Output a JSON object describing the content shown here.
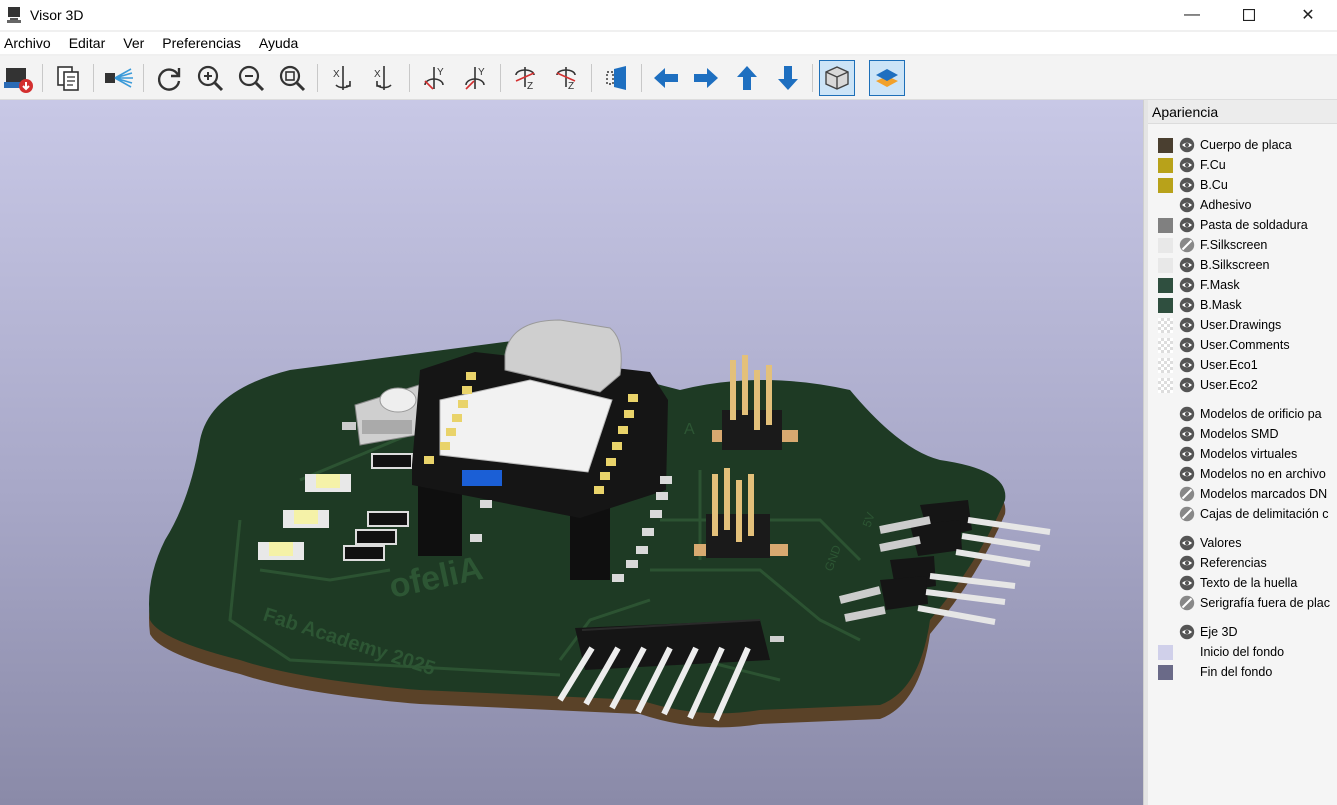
{
  "window": {
    "title": "Visor 3D"
  },
  "menu": [
    "Archivo",
    "Editar",
    "Ver",
    "Preferencias",
    "Ayuda"
  ],
  "panel": {
    "title": "Apariencia",
    "layers": [
      {
        "label": "Cuerpo de placa",
        "color": "#4a3f30",
        "visible": true
      },
      {
        "label": "F.Cu",
        "color": "#b8a21a",
        "visible": true
      },
      {
        "label": "B.Cu",
        "color": "#b8a21a",
        "visible": true
      },
      {
        "label": "Adhesivo",
        "color": "",
        "visible": true
      },
      {
        "label": "Pasta de soldadura",
        "color": "#808080",
        "visible": true
      },
      {
        "label": "F.Silkscreen",
        "color": "#e8e8e8",
        "visible": false
      },
      {
        "label": "B.Silkscreen",
        "color": "#e8e8e8",
        "visible": true
      },
      {
        "label": "F.Mask",
        "color": "#2f4f3f",
        "visible": true
      },
      {
        "label": "B.Mask",
        "color": "#2f4f3f",
        "visible": true
      },
      {
        "label": "User.Drawings",
        "color": "checker",
        "visible": true
      },
      {
        "label": "User.Comments",
        "color": "checker",
        "visible": true
      },
      {
        "label": "User.Eco1",
        "color": "checker",
        "visible": true
      },
      {
        "label": "User.Eco2",
        "color": "checker",
        "visible": true
      }
    ],
    "models": [
      {
        "label": "Modelos de orificio pa",
        "visible": true
      },
      {
        "label": "Modelos SMD",
        "visible": true
      },
      {
        "label": "Modelos virtuales",
        "visible": true
      },
      {
        "label": "Modelos no en archivo",
        "visible": true
      },
      {
        "label": "Modelos marcados DN",
        "visible": false
      },
      {
        "label": "Cajas de delimitación c",
        "visible": false
      }
    ],
    "texts": [
      {
        "label": "Valores",
        "visible": true
      },
      {
        "label": "Referencias",
        "visible": true
      },
      {
        "label": "Texto de la huella",
        "visible": true
      },
      {
        "label": "Serigrafía fuera de plac",
        "visible": false
      }
    ],
    "other": [
      {
        "label": "Eje 3D",
        "color": "",
        "visible": true
      },
      {
        "label": "Inicio del fondo",
        "color": "#d0d0ea",
        "visible": null
      },
      {
        "label": "Fin del fondo",
        "color": "#6a6a88",
        "visible": null
      }
    ]
  },
  "board": {
    "silk_text_1": "ofeliA",
    "silk_text_2": "Fab Academy 2025",
    "silk_label_gnd": "GND",
    "silk_label_5v": "5V",
    "silk_label_a": "A"
  }
}
